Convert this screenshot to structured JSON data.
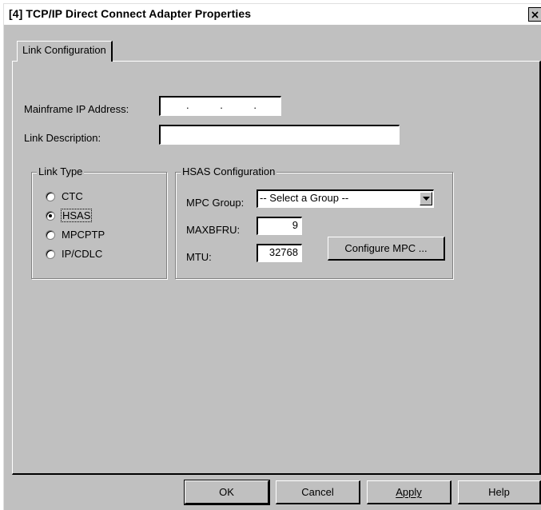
{
  "window": {
    "title": "[4] TCP/IP Direct Connect Adapter Properties"
  },
  "tabs": [
    {
      "label": "Link Configuration"
    }
  ],
  "fields": {
    "mainframe_ip_label": "Mainframe IP Address:",
    "ip_separators": [
      ".",
      ".",
      "."
    ],
    "link_description_label": "Link Description:",
    "link_description_value": ""
  },
  "link_type": {
    "legend": "Link Type",
    "options": [
      "CTC",
      "HSAS",
      "MPCPTP",
      "IP/CDLC"
    ],
    "selected": "HSAS"
  },
  "hsas": {
    "legend": "HSAS Configuration",
    "mpc_group_label": "MPC Group:",
    "mpc_group_value": "-- Select a Group --",
    "maxbfru_label": "MAXBFRU:",
    "maxbfru_value": "9",
    "mtu_label": "MTU:",
    "mtu_value": "32768",
    "configure_button": "Configure MPC ..."
  },
  "buttons": {
    "ok": "OK",
    "cancel": "Cancel",
    "apply": "Apply",
    "help": "Help"
  }
}
